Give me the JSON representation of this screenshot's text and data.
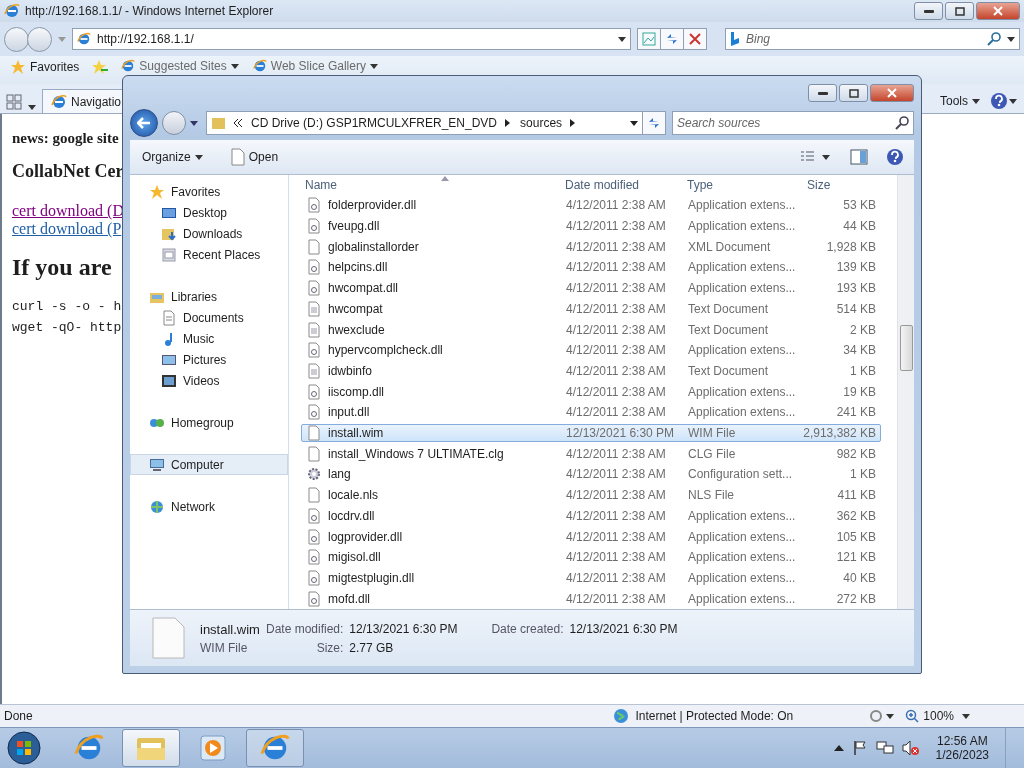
{
  "browser": {
    "title": "http://192.168.1.1/ - Windows Internet Explorer",
    "address": "http://192.168.1.1/",
    "search_placeholder": "Bing",
    "favorites_bar": {
      "label": "Favorites",
      "links": [
        "Suggested Sites",
        "Web Slice Gallery"
      ]
    },
    "command_bar": {
      "tab": "Navigatio",
      "tools": "Tools"
    },
    "content": {
      "news": "news: google site",
      "heading": "CollabNet Cer",
      "links": [
        {
          "text": "cert download (D",
          "visited": true
        },
        {
          "text": "cert download (P",
          "visited": false
        }
      ],
      "big_heading": "If you are",
      "code": [
        "curl -s -o - h",
        "wget -qO- http"
      ]
    },
    "status_bar": {
      "status": "Done",
      "zone": "Internet | Protected Mode: On",
      "zoom": "100%"
    }
  },
  "explorer": {
    "path": [
      "CD Drive (D:) GSP1RMCULXFRER_EN_DVD",
      "sources"
    ],
    "search_placeholder": "Search sources",
    "toolbar": [
      "Organize",
      "Open"
    ],
    "nav": [
      {
        "label": "Favorites",
        "kind": "star",
        "selected": false,
        "children": [
          {
            "label": "Desktop",
            "kind": "desktop",
            "selected": false
          },
          {
            "label": "Downloads",
            "kind": "downloads",
            "selected": false
          },
          {
            "label": "Recent Places",
            "kind": "recent",
            "selected": false
          }
        ]
      },
      {
        "label": "Libraries",
        "kind": "library",
        "selected": false,
        "children": [
          {
            "label": "Documents",
            "kind": "documents",
            "selected": false
          },
          {
            "label": "Music",
            "kind": "music",
            "selected": false
          },
          {
            "label": "Pictures",
            "kind": "pictures",
            "selected": false
          },
          {
            "label": "Videos",
            "kind": "videos",
            "selected": false
          }
        ]
      },
      {
        "label": "Homegroup",
        "kind": "homegroup",
        "selected": false
      },
      {
        "label": "Computer",
        "kind": "computer",
        "selected": true
      },
      {
        "label": "Network",
        "kind": "network",
        "selected": false
      }
    ],
    "columns": [
      "Name",
      "Date modified",
      "Type",
      "Size"
    ],
    "rows": [
      {
        "name": "folderprovider.dll",
        "date": "4/12/2011 2:38 AM",
        "type": "Application extens...",
        "size": "53 KB",
        "kind": "dll",
        "selected": false
      },
      {
        "name": "fveupg.dll",
        "date": "4/12/2011 2:38 AM",
        "type": "Application extens...",
        "size": "44 KB",
        "kind": "dll",
        "selected": false
      },
      {
        "name": "globalinstallorder",
        "date": "4/12/2011 2:38 AM",
        "type": "XML Document",
        "size": "1,928 KB",
        "kind": "file",
        "selected": false
      },
      {
        "name": "helpcins.dll",
        "date": "4/12/2011 2:38 AM",
        "type": "Application extens...",
        "size": "139 KB",
        "kind": "dll",
        "selected": false
      },
      {
        "name": "hwcompat.dll",
        "date": "4/12/2011 2:38 AM",
        "type": "Application extens...",
        "size": "193 KB",
        "kind": "dll",
        "selected": false
      },
      {
        "name": "hwcompat",
        "date": "4/12/2011 2:38 AM",
        "type": "Text Document",
        "size": "514 KB",
        "kind": "text",
        "selected": false
      },
      {
        "name": "hwexclude",
        "date": "4/12/2011 2:38 AM",
        "type": "Text Document",
        "size": "2 KB",
        "kind": "text",
        "selected": false
      },
      {
        "name": "hypervcomplcheck.dll",
        "date": "4/12/2011 2:38 AM",
        "type": "Application extens...",
        "size": "34 KB",
        "kind": "dll",
        "selected": false
      },
      {
        "name": "idwbinfo",
        "date": "4/12/2011 2:38 AM",
        "type": "Text Document",
        "size": "1 KB",
        "kind": "text",
        "selected": false
      },
      {
        "name": "iiscomp.dll",
        "date": "4/12/2011 2:38 AM",
        "type": "Application extens...",
        "size": "19 KB",
        "kind": "dll",
        "selected": false
      },
      {
        "name": "input.dll",
        "date": "4/12/2011 2:38 AM",
        "type": "Application extens...",
        "size": "241 KB",
        "kind": "dll",
        "selected": false
      },
      {
        "name": "install.wim",
        "date": "12/13/2021 6:30 PM",
        "type": "WIM File",
        "size": "2,913,382 KB",
        "kind": "file",
        "selected": true
      },
      {
        "name": "install_Windows 7 ULTIMATE.clg",
        "date": "4/12/2011 2:38 AM",
        "type": "CLG File",
        "size": "982 KB",
        "kind": "file",
        "selected": false
      },
      {
        "name": "lang",
        "date": "4/12/2011 2:38 AM",
        "type": "Configuration sett...",
        "size": "1 KB",
        "kind": "config",
        "selected": false
      },
      {
        "name": "locale.nls",
        "date": "4/12/2011 2:38 AM",
        "type": "NLS File",
        "size": "411 KB",
        "kind": "file",
        "selected": false
      },
      {
        "name": "locdrv.dll",
        "date": "4/12/2011 2:38 AM",
        "type": "Application extens...",
        "size": "362 KB",
        "kind": "dll",
        "selected": false
      },
      {
        "name": "logprovider.dll",
        "date": "4/12/2011 2:38 AM",
        "type": "Application extens...",
        "size": "105 KB",
        "kind": "dll",
        "selected": false
      },
      {
        "name": "migisol.dll",
        "date": "4/12/2011 2:38 AM",
        "type": "Application extens...",
        "size": "121 KB",
        "kind": "dll",
        "selected": false
      },
      {
        "name": "migtestplugin.dll",
        "date": "4/12/2011 2:38 AM",
        "type": "Application extens...",
        "size": "40 KB",
        "kind": "dll",
        "selected": false
      },
      {
        "name": "mofd.dll",
        "date": "4/12/2011 2:38 AM",
        "type": "Application extens...",
        "size": "272 KB",
        "kind": "dll",
        "selected": false
      }
    ],
    "details": {
      "name": "install.wim",
      "type": "WIM File",
      "modified_label": "Date modified:",
      "modified": "12/13/2021 6:30 PM",
      "size_label": "Size:",
      "size": "2.77 GB",
      "created_label": "Date created:",
      "created": "12/13/2021 6:30 PM"
    }
  },
  "taskbar": {
    "items": [
      {
        "kind": "ie",
        "running": false,
        "selected": false
      },
      {
        "kind": "folder",
        "running": true,
        "selected": true
      },
      {
        "kind": "media",
        "running": false,
        "selected": false
      },
      {
        "kind": "ie",
        "running": true,
        "selected": false
      }
    ],
    "time": "12:56 AM",
    "date": "1/26/2023"
  }
}
